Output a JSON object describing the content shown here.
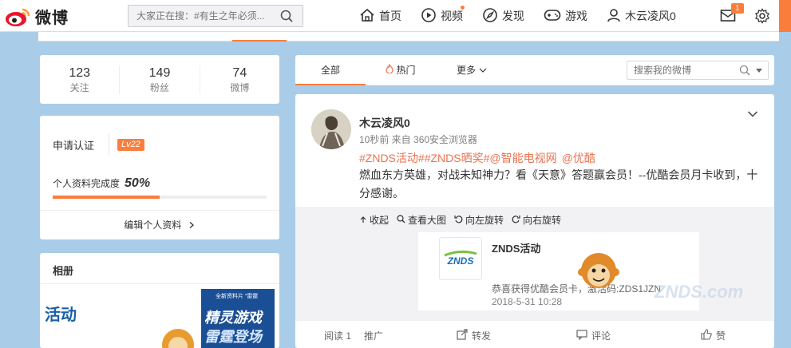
{
  "header": {
    "logo_text": "微博",
    "search_placeholder": "大家正在搜：#有生之年必须...",
    "nav": [
      {
        "label": "首页",
        "icon": "home-icon"
      },
      {
        "label": "视频",
        "icon": "video-icon"
      },
      {
        "label": "发现",
        "icon": "compass-icon"
      },
      {
        "label": "游戏",
        "icon": "gamepad-icon"
      },
      {
        "label": "木云凌风0",
        "icon": "user-icon"
      }
    ],
    "mail_badge": "1"
  },
  "stats": [
    {
      "num": "123",
      "label": "关注"
    },
    {
      "num": "149",
      "label": "粉丝"
    },
    {
      "num": "74",
      "label": "微博"
    }
  ],
  "profile": {
    "verify_label": "申请认证",
    "level": "Lv22",
    "complete_label": "个人资料完成度",
    "complete_pct": "50%",
    "complete_value": 0.5,
    "edit_label": "编辑个人资料"
  },
  "album": {
    "title": "相册",
    "thumb1_text": "活动",
    "thumb2_small": "全新资料片 “雷霆",
    "thumb2_line1": "精灵游戏",
    "thumb2_line2": "雷霆登场"
  },
  "feed_tabs": {
    "all": "全部",
    "hot": "热门",
    "more": "更多",
    "search_placeholder": "搜索我的微博"
  },
  "post": {
    "username": "木云凌风0",
    "meta": "10秒前 来自 360安全浏览器",
    "tags": [
      "#ZNDS活动#",
      "#ZNDS晒奖#",
      "@智能电视网",
      "@优酷"
    ],
    "content": "燃血东方英雄，对战未知神力？看《天意》答题赢会员！--优酷会员月卡收到，十分感谢。",
    "media_tools": [
      "收起",
      "查看大图",
      "向左旋转",
      "向右旋转"
    ],
    "mini_card": {
      "logo_text": "ZNDS",
      "title": "ZNDS活动",
      "desc": "恭喜获得优酷会员卡，激活码:ZDS1JZN",
      "date": "2018-5-31 10:28"
    },
    "watermark": "ZNDS.com",
    "actions": {
      "read": "阅读 1",
      "promote": "推广",
      "forward": "转发",
      "comment": "评论",
      "like": "赞"
    }
  },
  "colors": {
    "accent": "#fa7d3c",
    "tag": "#eb7350",
    "background": "#a9cde9"
  }
}
